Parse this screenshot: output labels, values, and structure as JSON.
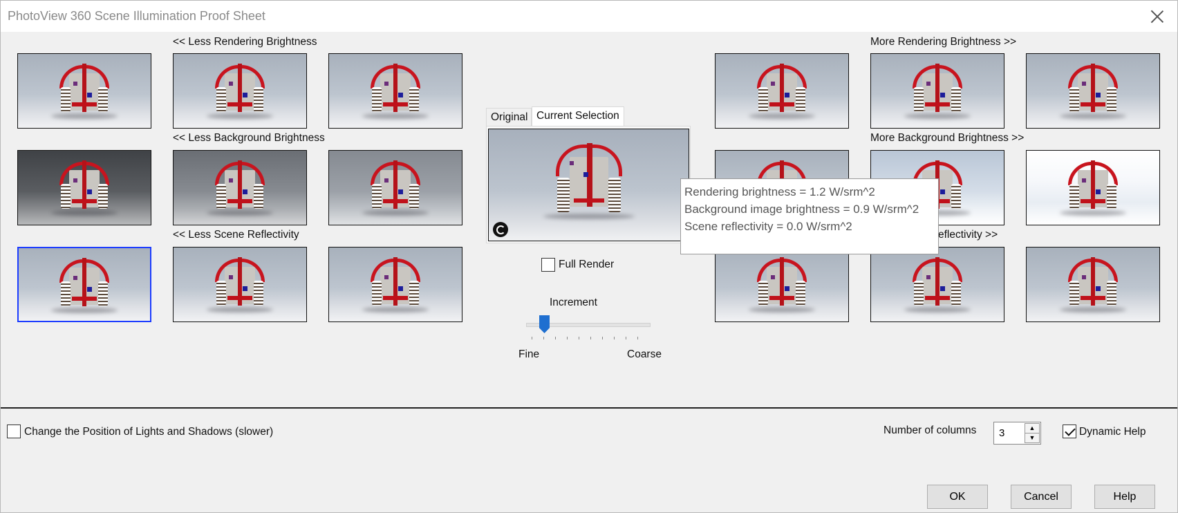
{
  "window": {
    "title": "PhotoView 360 Scene Illumination Proof Sheet"
  },
  "groups": {
    "less_rendering": "<< Less Rendering Brightness",
    "more_rendering": "More Rendering Brightness >>",
    "less_background": "<< Less Background Brightness",
    "more_background": "More Background Brightness >>",
    "less_reflectivity": "<< Less Scene Reflectivity",
    "more_reflectivity_visible": "eflectivity >>"
  },
  "preview": {
    "tabs": [
      "Original",
      "Current Selection"
    ],
    "active_tab": "Current Selection",
    "full_render_label": "Full Render",
    "full_render_checked": false
  },
  "increment": {
    "label": "Increment",
    "min_label": "Fine",
    "max_label": "Coarse",
    "position_fraction": 0.12
  },
  "tooltip": {
    "line1": "Rendering brightness = 1.2 W/srm^2",
    "line2": "Background image brightness = 0.9 W/srm^2",
    "line3": "Scene reflectivity = 0.0 W/srm^2"
  },
  "footer": {
    "lights_label": "Change the Position of Lights and Shadows (slower)",
    "lights_checked": false,
    "columns_label": "Number of columns",
    "columns_value": "3",
    "dynamic_help_label": "Dynamic Help",
    "dynamic_help_checked": true,
    "ok": "OK",
    "cancel": "Cancel",
    "help": "Help"
  },
  "colors": {
    "selection_border": "#1c3cff",
    "slider_accent": "#1f6fd0",
    "robot_red": "#c8141e"
  }
}
